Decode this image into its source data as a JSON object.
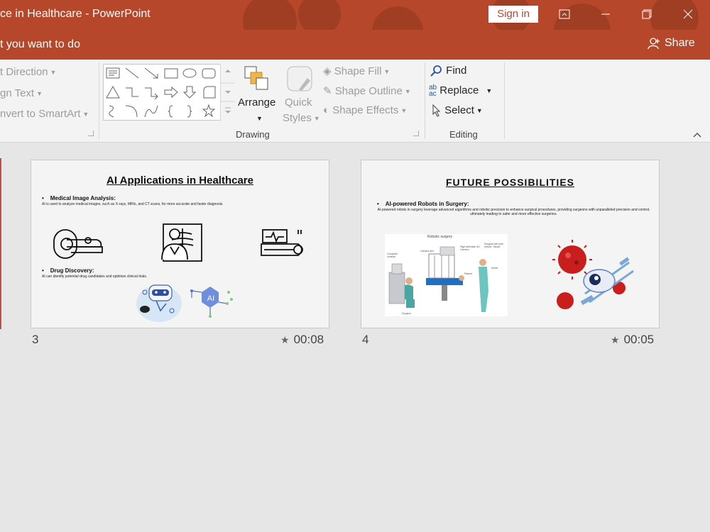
{
  "window": {
    "title": "ce in Healthcare  -  PowerPoint",
    "sign_in": "Sign in",
    "tell_me": "t you want to do",
    "share": "Share"
  },
  "ribbon": {
    "paragraph": {
      "text_direction": "t Direction",
      "align_text": "gn Text",
      "convert_smartart": "nvert to SmartArt"
    },
    "drawing": {
      "label": "Drawing",
      "arrange": "Arrange",
      "quick_styles_line1": "Quick",
      "quick_styles_line2": "Styles",
      "shape_fill": "Shape Fill",
      "shape_outline": "Shape Outline",
      "shape_effects": "Shape Effects"
    },
    "editing": {
      "label": "Editing",
      "find": "Find",
      "replace": "Replace",
      "select": "Select"
    }
  },
  "slides": [
    {
      "number": "3",
      "duration": "00:08",
      "title": "AI Applications in Healthcare",
      "bullet1_heading": "Medical Image Analysis:",
      "bullet1_body": "AI is used to analyze medical images, such as X-rays, MRIs, and CT scans, for more accurate and faster diagnosis.",
      "bullet2_heading": "Drug Discovery:",
      "bullet2_body": "AI can identify potential drug candidates and optimize clinical trials."
    },
    {
      "number": "4",
      "duration": "00:05",
      "title": "FUTURE POSSIBILITIES",
      "bullet1_heading": "AI-powered Robots in Surgery:",
      "bullet1_body": "AI-powered robots in surgery leverage advanced algorithms and robotic precision to enhance surgical procedures, providing surgeons with unparalleled precision and control, ultimately leading to safer and more effective surgeries.",
      "diagram_title": "Robotic surgery",
      "diagram_labels": [
        "Computer console",
        "Camera arm",
        "High-definition 3D Camera",
        "Surgical cart with robotic \"hands\"",
        "Patient",
        "Nurse",
        "Surgeon"
      ]
    }
  ],
  "colors": {
    "accent": "#b7472a",
    "ribbon_bg": "#f3f3f3",
    "workspace_bg": "#e6e6e6"
  }
}
